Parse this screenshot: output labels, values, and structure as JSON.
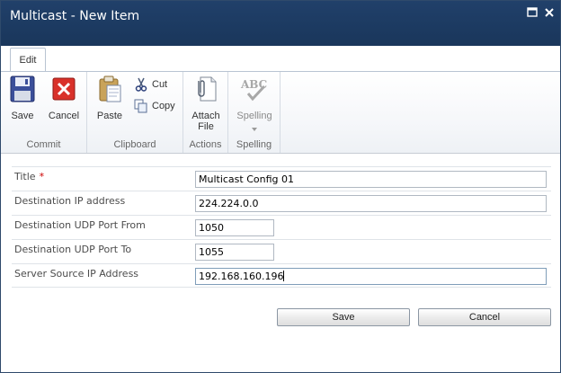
{
  "window": {
    "title": "Multicast - New Item",
    "maximize_icon": "maximize-icon",
    "close_icon": "close-icon"
  },
  "tabs": [
    {
      "label": "Edit",
      "selected": true
    }
  ],
  "ribbon": {
    "commit": {
      "label": "Commit",
      "save": {
        "label": "Save",
        "icon": "floppy-disk-icon"
      },
      "cancel": {
        "label": "Cancel",
        "icon": "cancel-x-icon"
      }
    },
    "clipboard": {
      "label": "Clipboard",
      "paste": {
        "label": "Paste",
        "icon": "clipboard-paste-icon"
      },
      "cut": {
        "label": "Cut",
        "icon": "scissors-icon"
      },
      "copy": {
        "label": "Copy",
        "icon": "copy-icon"
      }
    },
    "actions": {
      "label": "Actions",
      "attach_line1": "Attach",
      "attach_line2": "File",
      "icon": "paperclip-icon"
    },
    "spelling": {
      "label": "Spelling",
      "button": {
        "label": "Spelling",
        "icon": "abc-check-icon",
        "dropdown": "chevron-down-icon"
      }
    }
  },
  "form": {
    "required_marker": "*",
    "fields": [
      {
        "label": "Title",
        "value": "Multicast Config 01",
        "required": true
      },
      {
        "label": "Destination IP address",
        "value": "224.224.0.0"
      },
      {
        "label": "Destination UDP Port From",
        "value": "1050"
      },
      {
        "label": "Destination UDP Port To",
        "value": "1055"
      },
      {
        "label": "Server Source IP Address",
        "value": "192.168.160.196",
        "focused": true
      }
    ]
  },
  "buttons": {
    "save": "Save",
    "cancel": "Cancel"
  },
  "colors": {
    "titlebar": "#1c3a61",
    "required": "#cc0000",
    "border": "#2f4a6b"
  }
}
